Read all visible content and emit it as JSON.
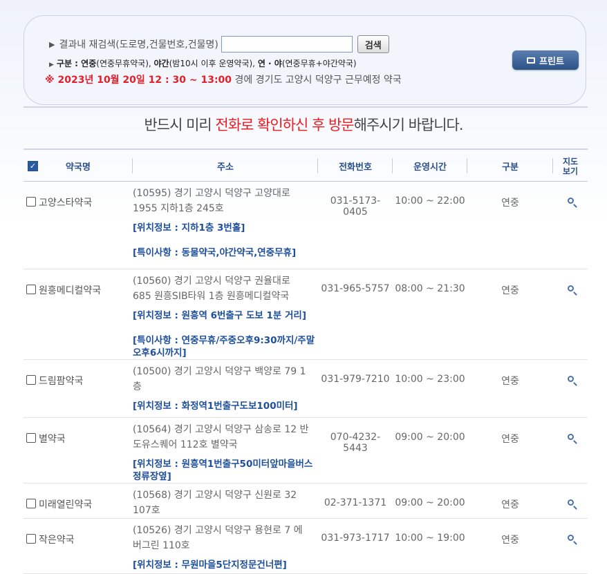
{
  "search": {
    "label": "결과내 재검색(도로명,건물번호,건물명)",
    "input_value": "",
    "button": "검색",
    "legend_prefix": "구분 : ",
    "legend_1": "연중",
    "legend_1d": "(연중무휴약국), ",
    "legend_2": "야간",
    "legend_2d": "(밤10시 이후 운영약국), ",
    "legend_3": "연 · 야",
    "legend_3d": "(연중무휴+야간약국)",
    "mark": "※ 2023년 10월 20일 12 : 30 ~ 13:00",
    "date_suffix": " 경에  경기도  고양시 덕양구   근무예정 약국",
    "print": "프린트"
  },
  "notice": {
    "pre": "반드시 미리 ",
    "hl": "전화로 확인하신 후 방문",
    "post": "해주시기 바랍니다."
  },
  "headers": {
    "name": "약국명",
    "addr": "주소",
    "tel": "전화번호",
    "hours": "운영시간",
    "type": "구분",
    "map": "지도보기"
  },
  "rows": [
    {
      "name": "고양스타약국",
      "addr": "(10595) 경기 고양시 덕양구 고양대로 1955 지하1층 245호",
      "tel": "031-5173-0405",
      "hours": "10:00 ~ 22:00",
      "type": "연중",
      "loc": "[위치정보 : 지하1층 3번홀]",
      "note": "[특이사항 : 동물약국,야간약국,연중무휴]"
    },
    {
      "name": "원흥메디컬약국",
      "addr": "(10560) 경기 고양시 덕양구 권율대로 685 원흥SIB타워 1층 원흥메디컬약국",
      "tel": "031-965-5757",
      "hours": "08:00 ~ 21:30",
      "type": "연중",
      "loc": "[위치정보 : 원흥역 6번출구 도보 1분 거리]",
      "note": "[특이사항 : 연중무휴/주중오후9:30까지/주말오후6시까지]"
    },
    {
      "name": "드림팜약국",
      "addr": "(10500) 경기 고양시 덕양구 백양로 79 1층",
      "tel": "031-979-7210",
      "hours": "10:00 ~ 23:00",
      "type": "연중",
      "loc": "[위치정보 : 화정역1번출구도보100미터]",
      "note": ""
    },
    {
      "name": "별약국",
      "addr": "(10564) 경기 고양시 덕양구 삼송로 12 반도유스퀘어 112호 별약국",
      "tel": "070-4232-5443",
      "hours": "09:00 ~ 20:00",
      "type": "연중",
      "loc": "[위치정보 : 원흥역1번출구50미터앞마을버스정류장옆]",
      "note": ""
    },
    {
      "name": "미래열린약국",
      "addr": "(10568) 경기 고양시 덕양구 신원로 32 107호",
      "tel": "02-371-1371",
      "hours": "09:00 ~ 20:00",
      "type": "연중",
      "loc": "",
      "note": ""
    },
    {
      "name": "작은약국",
      "addr": "(10526) 경기 고양시 덕양구 용현로 7 에버그린 110호",
      "tel": "031-973-1717",
      "hours": "10:00 ~ 19:00",
      "type": "연중",
      "loc": "[위치정보 : 무원마을5단지정문건너편]",
      "note": ""
    }
  ]
}
